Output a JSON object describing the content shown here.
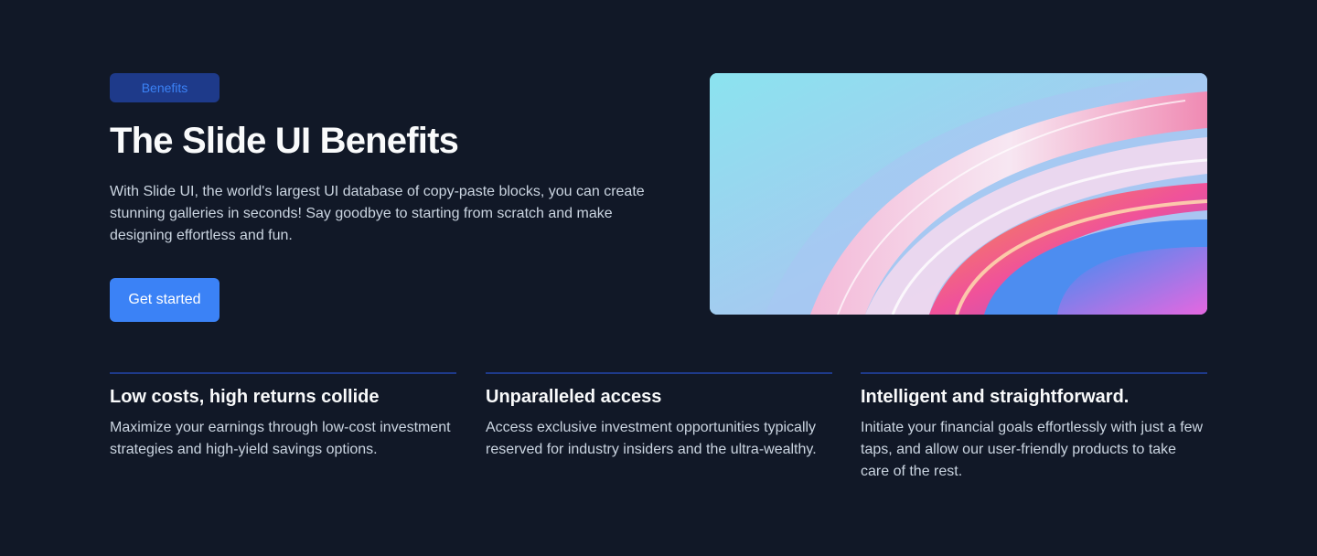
{
  "hero": {
    "badge": "Benefits",
    "title": "The Slide UI Benefits",
    "description": "With Slide UI, the world's largest UI database of copy-paste blocks, you can create stunning galleries in seconds! Say goodbye to starting from scratch and make designing effortless and fun.",
    "cta_label": "Get started"
  },
  "features": [
    {
      "title": "Low costs, high returns collide",
      "description": "Maximize your earnings through low-cost investment strategies and high-yield savings options."
    },
    {
      "title": "Unparalleled access",
      "description": "Access exclusive investment opportunities typically reserved for industry insiders and the ultra-wealthy."
    },
    {
      "title": "Intelligent and straightforward.",
      "description": "Initiate your financial goals effortlessly with just a few taps, and allow our user-friendly products to take care of the rest."
    }
  ],
  "colors": {
    "background": "#111827",
    "accent": "#3b82f6",
    "badge_bg": "#1e3a8a",
    "divider": "#1e3a8a"
  }
}
